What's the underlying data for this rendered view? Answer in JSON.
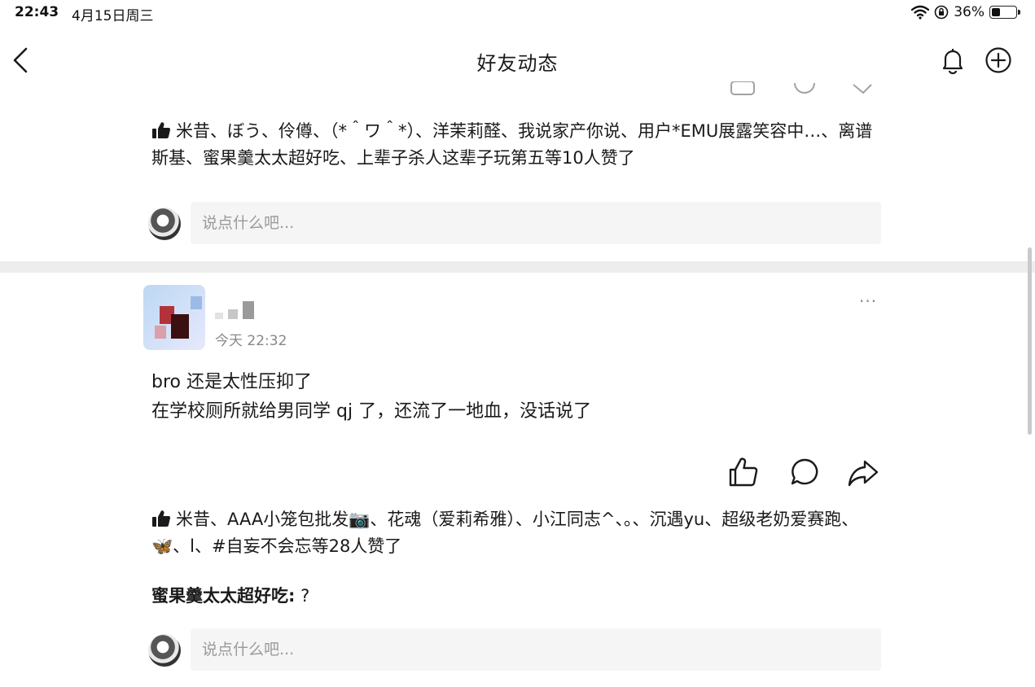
{
  "status_bar": {
    "time": "22:43",
    "date": "4月15日周三",
    "battery": "36%",
    "battery_level": 0.36
  },
  "nav": {
    "title": "好友动态"
  },
  "post_prev": {
    "likes_text": "米昔、ぼう、伶僔、（*＾ワ＾*）、洋茉莉醛、我说家产你说、用户*EMU展露笑容中…、离谱斯基、蜜果羹太太超好吃、上辈子杀人这辈子玩第五等10人赞了",
    "comment_placeholder": "说点什么吧..."
  },
  "post": {
    "time": "今天 22:32",
    "more": "···",
    "body_lines": [
      "bro 还是太性压抑了",
      "在学校厕所就给男同学 qj 了，还流了一地血，没话说了"
    ],
    "likes_text": "米昔、AAA小笼包批发📷、花魂（爱莉希雅）、小江同志^、。、沉遇yu、超级老奶爱赛跑、🦋、l、#自妄不会忘等28人赞了",
    "comment": {
      "author": "蜜果羹太太超好吃",
      "separator": ":",
      "text": " ?"
    },
    "comment_placeholder": "说点什么吧..."
  },
  "colors": {
    "text": "#1a1a1a",
    "muted": "#888888",
    "placeholder": "#9a9a9a",
    "input_bg": "#f5f5f5",
    "divider": "#ededed"
  },
  "icons": [
    "back-icon",
    "bell-icon",
    "add-circle-icon",
    "thumb-icon",
    "like-icon",
    "comment-icon",
    "share-icon",
    "wifi-icon",
    "lock-rotation-icon",
    "battery-icon"
  ]
}
